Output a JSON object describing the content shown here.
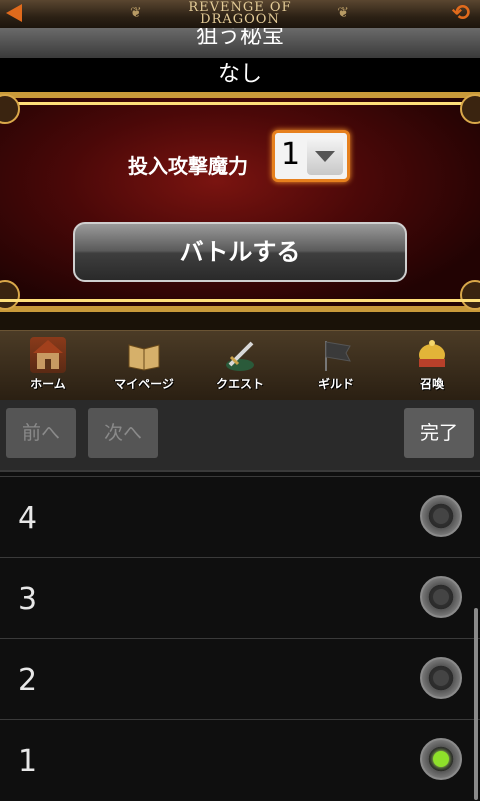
{
  "header": {
    "logo_line1": "Revenge Of",
    "logo_line2": "Dragoon",
    "back_icon": "back-arrow-icon",
    "reload_icon": "reload-icon",
    "accent": "#e06a1c"
  },
  "target": {
    "label": "狙う秘宝",
    "value": "なし"
  },
  "battle": {
    "power_label": "投入攻撃魔力",
    "power_value": "1",
    "button_label": "バトルする"
  },
  "nav": {
    "items": [
      {
        "label": "ホーム",
        "icon": "home-icon"
      },
      {
        "label": "マイページ",
        "icon": "book-icon"
      },
      {
        "label": "クエスト",
        "icon": "sword-icon"
      },
      {
        "label": "ギルド",
        "icon": "flag-icon"
      },
      {
        "label": "召喚",
        "icon": "crown-icon"
      }
    ]
  },
  "toolbar": {
    "prev_label": "前へ",
    "next_label": "次へ",
    "done_label": "完了"
  },
  "picker": {
    "options": [
      {
        "label": "4",
        "selected": false
      },
      {
        "label": "3",
        "selected": false
      },
      {
        "label": "2",
        "selected": false
      },
      {
        "label": "1",
        "selected": true
      }
    ],
    "selected_color": "#8ee02a"
  }
}
